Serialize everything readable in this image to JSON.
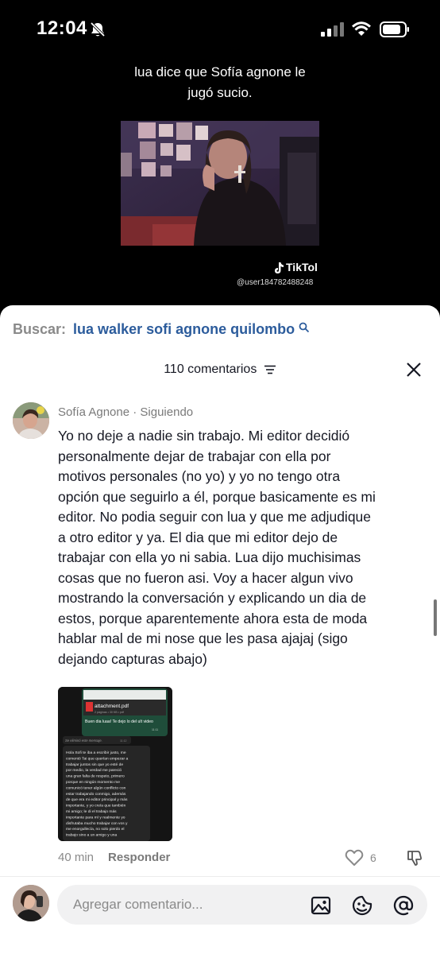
{
  "status_bar": {
    "time": "12:04",
    "icons": [
      "bell-off-icon",
      "signal-icon",
      "wifi-icon",
      "battery-icon"
    ]
  },
  "video": {
    "caption_line1": "lua dice que Sofía agnone le",
    "caption_line2": "jugó sucio.",
    "watermark": "TikTol",
    "username": "@user184782488248"
  },
  "search": {
    "label": "Buscar:",
    "query": "lua walker sofi agnone quilombo"
  },
  "comments_header": {
    "count_label": "110 comentarios"
  },
  "comment": {
    "author": "Sofía Agnone · Siguiendo",
    "lines": [
      "Yo no deje a nadie sin trabajo. Mi editor decidió",
      "personalmente dejar de trabajar con ella por",
      "motivos personales (no yo) y yo no tengo otra",
      "opción que seguirlo a él, porque basicamente es mi",
      "editor. No podia seguir con lua y que me adjudique",
      "a otro editor y ya. El dia que mi editor dejo de",
      "trabajar con ella yo ni sabia. Lua dijo muchisimas",
      "cosas que no fueron asi. Voy a hacer algun vivo",
      "mostrando la conversación y explicando un dia de",
      "estos, porque aparentemente ahora esta de moda",
      "hablar mal de mi nose que les pasa ajajaj (sigo",
      "dejando capturas abajo)"
    ],
    "time": "40 min",
    "reply_label": "Responder",
    "like_count": "6",
    "attachment": {
      "file_name": "attachment.pdf",
      "file_meta": "2 páginas • 30 KB • pdf",
      "bubble_text": "Buen dia luaa! Te dejo lo del ult video",
      "bubble_time": "11:11",
      "deleted_text": "Se eliminó este mensaje.",
      "deleted_time": "11:12",
      "message_lines": [
        "Hola Sofi te iba a escribir justo, me",
        "comentó Tai que querían empezar a",
        "trabajar juntos sin que yo esté de",
        "por medio, la verdad me pareció",
        "una gran falta de respeto, primero",
        "porque en ningún momento me",
        "comunicó tener algún conflicto con",
        "estar trabajando conmigo, además",
        "de que era mi editor principal y más",
        "importante, y yo creía que también",
        "mi amigo; le di el trabajo más",
        "importante para mí y realmente yo",
        "disfrutaba mucho trabajar con vos y",
        "me enorgullecía, no solo pierdo el",
        "trabajo sino a un amigo y una"
      ]
    }
  },
  "footer": {
    "placeholder": "Agregar comentario..."
  },
  "colors": {
    "search_query": "#2c5c9c",
    "text_primary": "#161823",
    "text_secondary": "#8a8a8a",
    "input_bg": "#f1f1f2"
  }
}
